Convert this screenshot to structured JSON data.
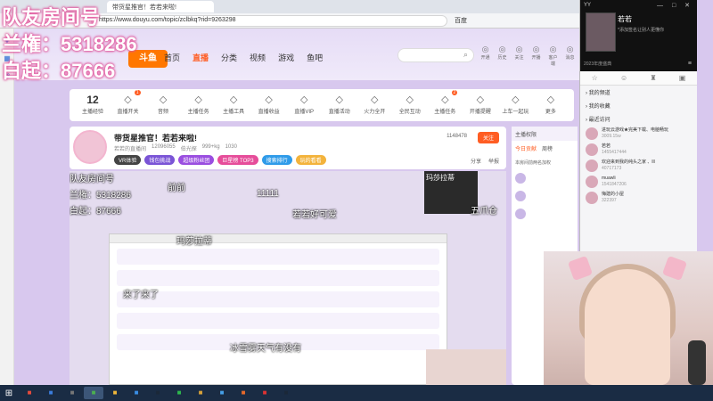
{
  "overlay": {
    "line1": "队友房间号",
    "line2": "兰権：5318286",
    "line3": "白起：87666"
  },
  "browser": {
    "tab_title": "带货星推官！若若来啦!",
    "url": "https://www.douyu.com/topic/zclbkq?rid=9263298",
    "bookmark": "百度"
  },
  "douyu": {
    "logo": "斗鱼",
    "nav": [
      {
        "label": "首页"
      },
      {
        "label": "直播",
        "active": true
      },
      {
        "label": "分类"
      },
      {
        "label": "视频"
      },
      {
        "label": "游戏"
      },
      {
        "label": "鱼吧"
      }
    ],
    "tools": [
      {
        "icon": "gift-icon",
        "label": "开通"
      },
      {
        "icon": "record-icon",
        "label": "历史"
      },
      {
        "icon": "follow-icon",
        "label": "关注"
      },
      {
        "icon": "live-icon",
        "label": "开播"
      },
      {
        "icon": "client-icon",
        "label": "客户端"
      },
      {
        "icon": "message-icon",
        "label": "消息"
      },
      {
        "icon": "user-icon",
        "label": "个人中心"
      }
    ]
  },
  "toolbar": {
    "level": "12",
    "level_label": "主播经验",
    "items": [
      {
        "label": "直播开关",
        "badge": "1"
      },
      {
        "label": "音频"
      },
      {
        "label": "主播任务"
      },
      {
        "label": "主播工具"
      },
      {
        "label": "直播收益"
      },
      {
        "label": "直播VIP"
      },
      {
        "label": "直播活动"
      },
      {
        "label": "火力全开"
      },
      {
        "label": "全民互动"
      },
      {
        "label": "主播任务",
        "badge": "2"
      },
      {
        "label": "开播提醒"
      },
      {
        "label": "上车一起玩"
      },
      {
        "label": "更多"
      }
    ]
  },
  "room": {
    "title": "带货星推官！若若来啦!",
    "meta": [
      "若若的直播间",
      "12096055",
      "伯光探",
      "999+kg",
      "1030"
    ],
    "badges": [
      {
        "label": "VR体验",
        "color": "#444"
      },
      {
        "label": "钱包挑战",
        "color": "#7a54d6"
      },
      {
        "label": "超级粉丝团",
        "color": "#9a4ee0"
      },
      {
        "label": "巨星榜 TOP3",
        "color": "#e64d9a"
      },
      {
        "label": "搜索排行",
        "color": "#2f9be9"
      },
      {
        "label": "玩的看看",
        "color": "#f3b33c"
      }
    ],
    "sub_count": "1148478",
    "subscribe": "关注",
    "actions": [
      "分享",
      "举报"
    ]
  },
  "stream": {
    "mini_card_title": "玛莎拉蒂",
    "danmu": [
      "队友房间号",
      "兰権：5318286",
      "白起：87666",
      "五爪仓",
      "前前",
      "11111",
      "若若好可爱",
      "玛莎拉蒂",
      "来了来了",
      "冰雪雾天气有没有"
    ]
  },
  "rank": {
    "head": "主播权限",
    "tabs": [
      {
        "label": "今日贡献",
        "on": true
      },
      {
        "label": "周榜"
      }
    ],
    "note": "本房间前两名加权"
  },
  "yy": {
    "title": "YY",
    "name": "若若",
    "sign": "*添加签名让别人更懂你",
    "year": "2023年度盛典",
    "sections": [
      "我的频道",
      "我的收藏",
      "最近访问"
    ],
    "contacts": [
      {
        "name": "进玩云游戏★完美下载、电脑畅玩",
        "id": "3009.15w"
      },
      {
        "name": "若若",
        "id": "1455417444"
      },
      {
        "name": "欢迎来到我的纯头之家 、lll",
        "id": "40717173"
      },
      {
        "name": "muawli",
        "id": "1541847206"
      },
      {
        "name": "悔建的小屋",
        "id": "322397"
      }
    ]
  },
  "taskbar": {
    "icons": [
      "browser-icon",
      "explorer-icon",
      "settings-icon",
      "chrome-icon",
      "folder-icon",
      "app-icon",
      "steam-icon",
      "wechat-icon",
      "game-icon",
      "app2-icon",
      "app3-icon",
      "app4-icon",
      "steam2-icon"
    ]
  }
}
